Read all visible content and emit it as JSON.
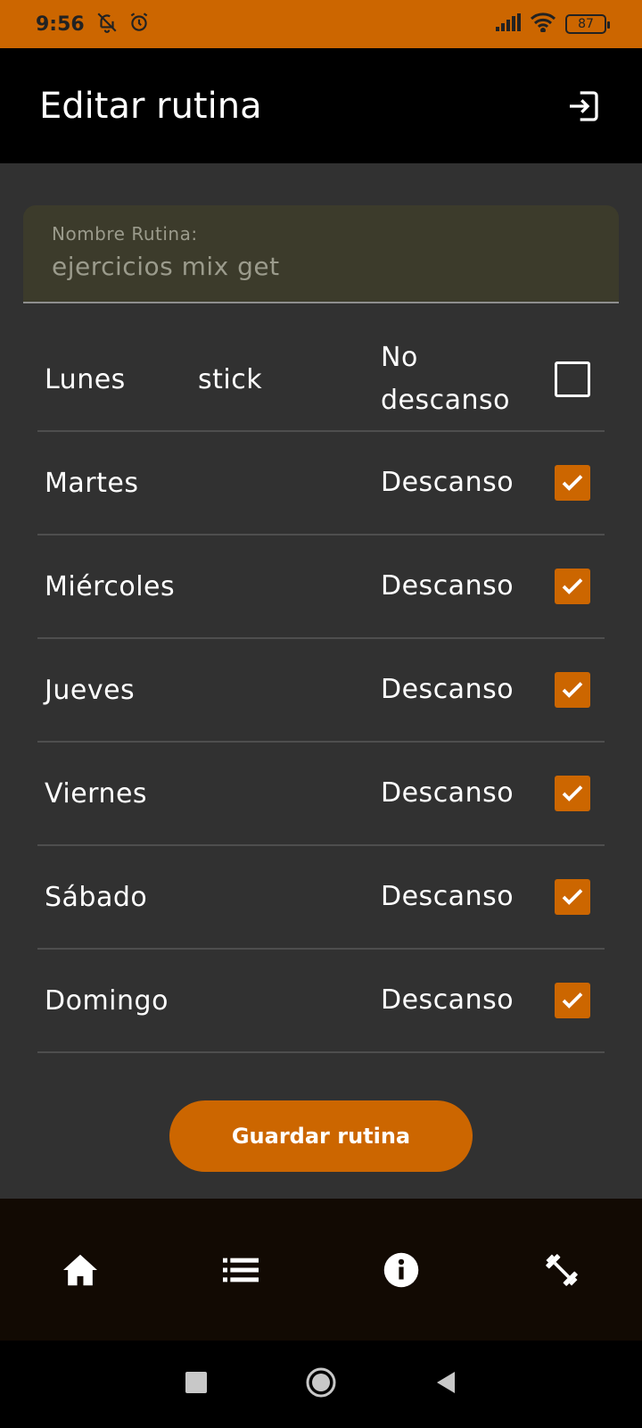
{
  "status_bar": {
    "time": "9:56",
    "battery": "87"
  },
  "app_bar": {
    "title": "Editar rutina"
  },
  "form": {
    "name_label": "Nombre Rutina:",
    "name_value": "ejercicios mix get"
  },
  "days": [
    {
      "day": "Lunes",
      "routine": "stick",
      "status": "No descanso",
      "checked": false
    },
    {
      "day": "Martes",
      "routine": "",
      "status": "Descanso",
      "checked": true
    },
    {
      "day": "Miércoles",
      "routine": "",
      "status": "Descanso",
      "checked": true
    },
    {
      "day": "Jueves",
      "routine": "",
      "status": "Descanso",
      "checked": true
    },
    {
      "day": "Viernes",
      "routine": "",
      "status": "Descanso",
      "checked": true
    },
    {
      "day": "Sábado",
      "routine": "",
      "status": "Descanso",
      "checked": true
    },
    {
      "day": "Domingo",
      "routine": "",
      "status": "Descanso",
      "checked": true
    }
  ],
  "save_button": "Guardar rutina",
  "bottom_nav": [
    "home-icon",
    "list-icon",
    "info-icon",
    "dumbbell-icon"
  ],
  "colors": {
    "accent": "#cc6600",
    "background": "#313131",
    "appbar": "#000000"
  }
}
